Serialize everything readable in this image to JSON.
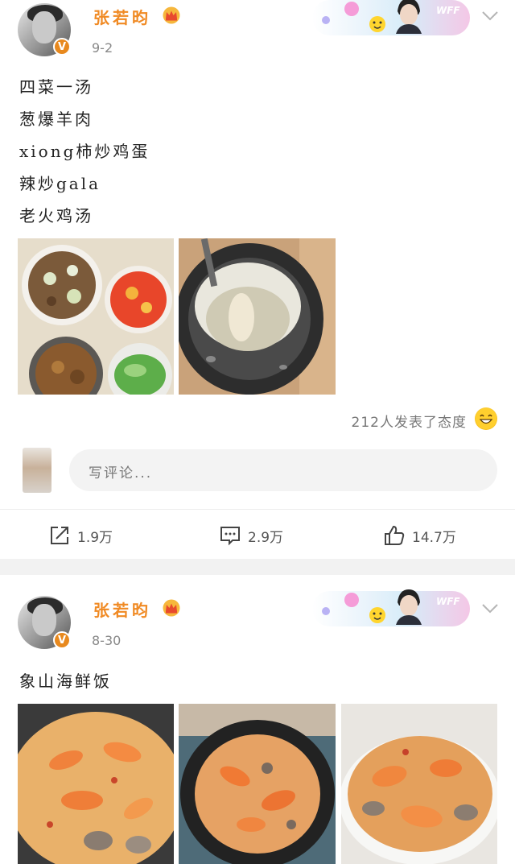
{
  "posts": [
    {
      "author": "张若昀",
      "date": "9-2",
      "verified_badge": "V",
      "lines": [
        "四菜一汤",
        "葱爆羊肉",
        "xiong柿炒鸡蛋",
        "辣炒gala",
        "老火鸡汤"
      ],
      "images": [
        "four-dishes-photo",
        "chicken-soup-pot-photo"
      ],
      "banner_label": "WFF",
      "reactions_text": "212人发表了态度",
      "comment_placeholder": "写评论...",
      "actions": {
        "share": "1.9万",
        "comment": "2.9万",
        "like": "14.7万"
      }
    },
    {
      "author": "张若昀",
      "date": "8-30",
      "verified_badge": "V",
      "lines": [
        "象山海鲜饭"
      ],
      "images": [
        "seafood-paella-photo-1",
        "seafood-paella-photo-2",
        "seafood-paella-photo-3"
      ],
      "banner_label": "WFF"
    }
  ],
  "icons": {
    "share": "share-icon",
    "comment": "comment-icon",
    "like": "thumbs-up-icon",
    "expand": "chevron-down-icon",
    "crown": "crown-icon"
  },
  "colors": {
    "username": "#f08a24",
    "badge": "#e8891e"
  }
}
